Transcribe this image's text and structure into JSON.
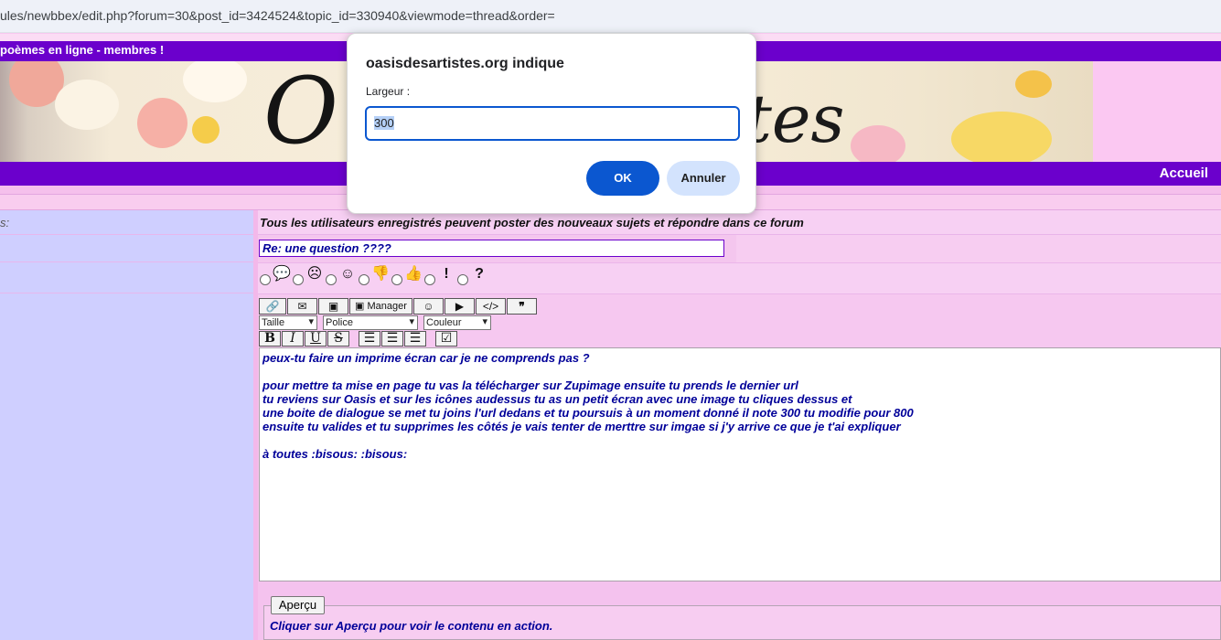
{
  "browser": {
    "url": "ules/newbbex/edit.php?forum=30&post_id=3424524&topic_id=330940&viewmode=thread&order="
  },
  "site": {
    "top_bar_text": "poèmes en ligne - membres !",
    "banner_title_left": "O",
    "banner_title_right": "tes",
    "nav_home": "Accueil"
  },
  "form": {
    "left_label": "s:",
    "permission_text": "Tous les utilisateurs enregistrés peuvent poster des nouveaux sujets et répondre dans ce forum",
    "subject_value": "Re: une question ????",
    "message_icons": [
      "speech-bubble-icon",
      "frown-icon",
      "smile-icon",
      "thumbs-down-icon",
      "thumbs-up-icon",
      "exclamation-icon",
      "question-icon"
    ],
    "message_icon_glyphs": [
      "💬",
      "☹",
      "☺",
      "👎",
      "👍",
      "!",
      "?"
    ],
    "toolbar": {
      "manager_label": "Manager",
      "size_select": "Taille",
      "font_select": "Police",
      "color_select": "Couleur"
    },
    "message_lines": [
      "peux-tu faire un imprime écran car je ne comprends pas ?",
      "",
      "pour mettre ta mise en page tu vas la télécharger sur Zupimage ensuite tu prends le dernier url",
      "tu reviens sur Oasis et sur les icônes audessus tu as un petit écran avec une image tu cliques dessus et",
      "une boite de dialogue se met tu joins l'url dedans et tu poursuis à un moment donné il note 300 tu modifie pour 800",
      "ensuite tu valides et tu supprimes les côtés je vais tenter de merttre sur imgae si j'y arrive ce que je t'ai expliquer",
      "",
      "à toutes :bisous:  :bisous:"
    ],
    "preview_button": "Aperçu",
    "preview_hint": "Cliquer sur Aperçu pour voir le contenu en action."
  },
  "dialog": {
    "title": "oasisdesartistes.org indique",
    "label": "Largeur :",
    "input_value": "300",
    "ok_label": "OK",
    "cancel_label": "Annuler"
  },
  "colors": {
    "accent_purple": "#6b00cc",
    "dialog_primary": "#0b57d0",
    "message_text": "#000099"
  }
}
